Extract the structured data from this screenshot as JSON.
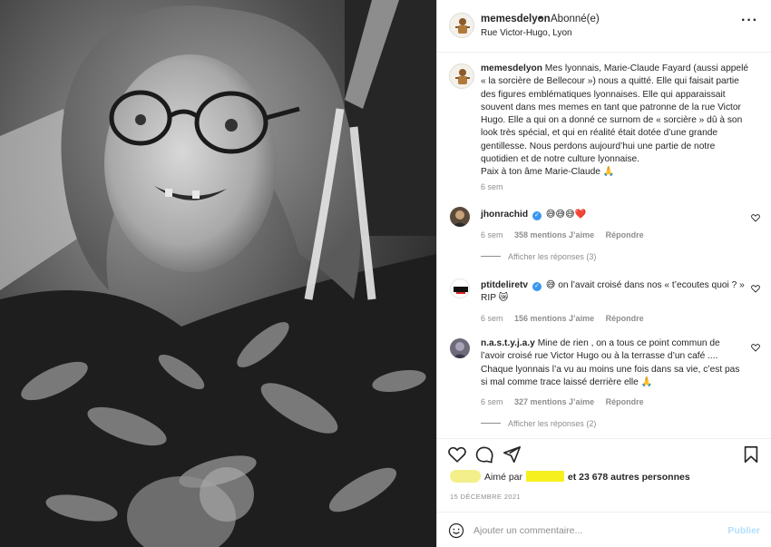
{
  "post": {
    "author": "memesdelyon",
    "follow_status": "Abonné(e)",
    "location": "Rue Victor-Hugo, Lyon",
    "more_icon": "more-dots-icon"
  },
  "caption": {
    "username": "memesdelyon",
    "text": "Mes lyonnais, Marie-Claude Fayard (aussi appelé « la sorcière de Bellecour ») nous a quitté. Elle qui faisait partie des figures emblématiques lyonnaises. Elle qui apparaissait souvent dans mes memes en tant que patronne de la rue Victor Hugo. Elle a qui on a donné ce surnom de « sorcière » dû à son look très spécial, et qui en réalité était dotée d’une grande gentillesse. Nous perdons aujourd’hui une partie de notre quotidien et de notre culture lyonnaise.",
    "signoff": "Paix à ton âme Marie-Claude 🙏",
    "age": "6 sem"
  },
  "comments": [
    {
      "username": "jhonrachid",
      "verified": true,
      "text": "😅😅😅❤️",
      "age": "6 sem",
      "likes": "358 mentions J’aime",
      "reply_label": "Répondre",
      "replies_label": "Afficher les réponses (3)"
    },
    {
      "username": "ptitdeliretv",
      "verified": true,
      "text": "😅 on l’avait croisé dans nos « t’ecoutes quoi ? » RIP 😿",
      "age": "6 sem",
      "likes": "156 mentions J’aime",
      "reply_label": "Répondre"
    },
    {
      "username": "n.a.s.t.y.j.a.y",
      "verified": false,
      "text": "Mine de rien , on a tous ce point commun de l’avoir croisé rue Victor Hugo ou à la terrasse d’un café .... Chaque lyonnais l’a vu au moins une fois dans sa vie, c’est pas si mal comme trace laissé derrière elle 🙏",
      "age": "6 sem",
      "likes": "327 mentions J’aime",
      "reply_label": "Répondre",
      "replies_label": "Afficher les réponses (2)"
    }
  ],
  "likes": {
    "prefix": "Aimé par",
    "suffix": "et 23 678 autres personnes"
  },
  "date": "15 DÉCEMBRE 2021",
  "comment_box": {
    "placeholder": "Ajouter un commentaire...",
    "publish_label": "Publier"
  },
  "colors": {
    "verified": "#3897f0",
    "publish_disabled": "#b2dffc",
    "redaction": "#f6f01f"
  }
}
